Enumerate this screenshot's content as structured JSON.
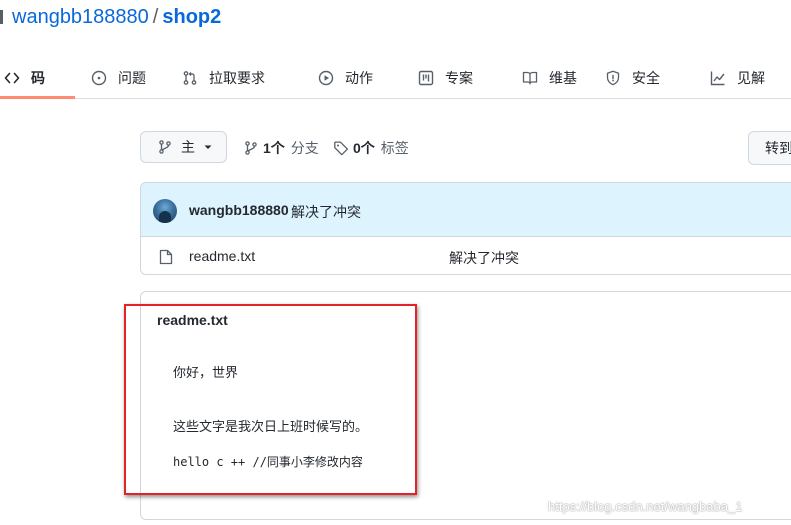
{
  "repo": {
    "owner": "wangbb188880",
    "separator": "/",
    "name": "shop2"
  },
  "tabs": [
    {
      "label": "码",
      "icon": "code-icon",
      "selected": true
    },
    {
      "label": "问题",
      "icon": "issue-icon"
    },
    {
      "label": "拉取要求",
      "icon": "pull-request-icon"
    },
    {
      "label": "动作",
      "icon": "play-icon"
    },
    {
      "label": "专案",
      "icon": "project-icon"
    },
    {
      "label": "维基",
      "icon": "book-icon"
    },
    {
      "label": "安全",
      "icon": "shield-icon"
    },
    {
      "label": "见解",
      "icon": "graph-icon"
    }
  ],
  "toolbar": {
    "branch_label": "主",
    "branch_count": "1个",
    "branch_text": "分支",
    "tag_count": "0个",
    "tag_text": "标签",
    "goto_label": "转到"
  },
  "commit": {
    "user": "wangbb188880",
    "message": "解决了冲突"
  },
  "files": [
    {
      "name": "readme.txt",
      "last_commit": "解决了冲突"
    }
  ],
  "readme": {
    "title": "readme.txt",
    "lines": [
      "你好，世界",
      "这些文字是我次日上班时候写的。",
      "hello c ++ //同事小李修改内容"
    ]
  },
  "annotation_color": "#e2232a",
  "watermark": "https://blog.csdn.net/wangbaba_1"
}
